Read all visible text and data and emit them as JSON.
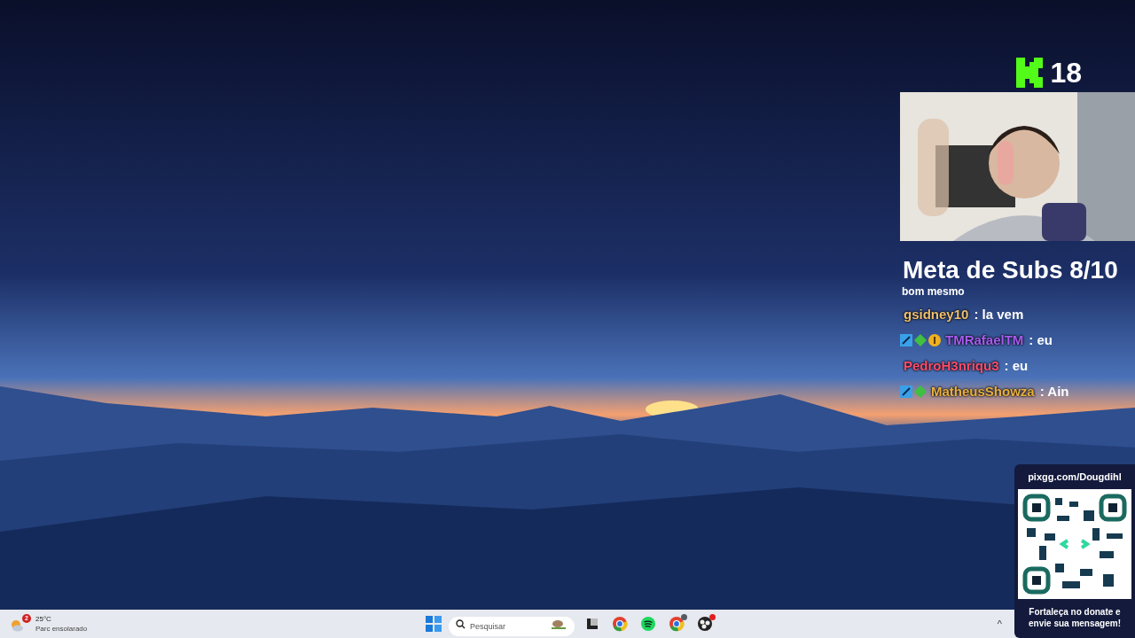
{
  "viewers": {
    "count": "18"
  },
  "goal": {
    "title": "Meta de Subs 8/10"
  },
  "chat": [
    {
      "text": "bom mesmo"
    },
    {
      "user": "gsidney10",
      "color": "#f0c070",
      "text": ": la vem"
    },
    {
      "user": "TMRafaelTM",
      "color": "#a85cf0",
      "text": ": eu",
      "badges": [
        {
          "kind": "mod"
        },
        {
          "kind": "vip"
        },
        {
          "kind": "sub"
        }
      ]
    },
    {
      "user": "PedroH3nriqu3",
      "color": "#ff4d6d",
      "text": ": eu"
    },
    {
      "user": "MatheusShowza",
      "color": "#e8b040",
      "text": ": Ain",
      "badges": [
        {
          "kind": "mod"
        },
        {
          "kind": "vip"
        }
      ]
    }
  ],
  "donate": {
    "url": "pixgg.com/Dougdihl",
    "message": "Fortaleça no donate e envie sua mensagem!"
  },
  "taskbar": {
    "weather": {
      "badge": "2",
      "temp": "25°C",
      "condition": "Parc ensolarado"
    },
    "search": {
      "placeholder": "Pesquisar"
    },
    "apps": [
      {
        "kind": "taskview",
        "badge": false
      },
      {
        "kind": "chrome",
        "badge": false
      },
      {
        "kind": "spotify",
        "badge": false
      },
      {
        "kind": "chrome",
        "badge": true
      },
      {
        "kind": "obs",
        "badge": true
      }
    ],
    "tray": {
      "chevron": "^"
    }
  }
}
